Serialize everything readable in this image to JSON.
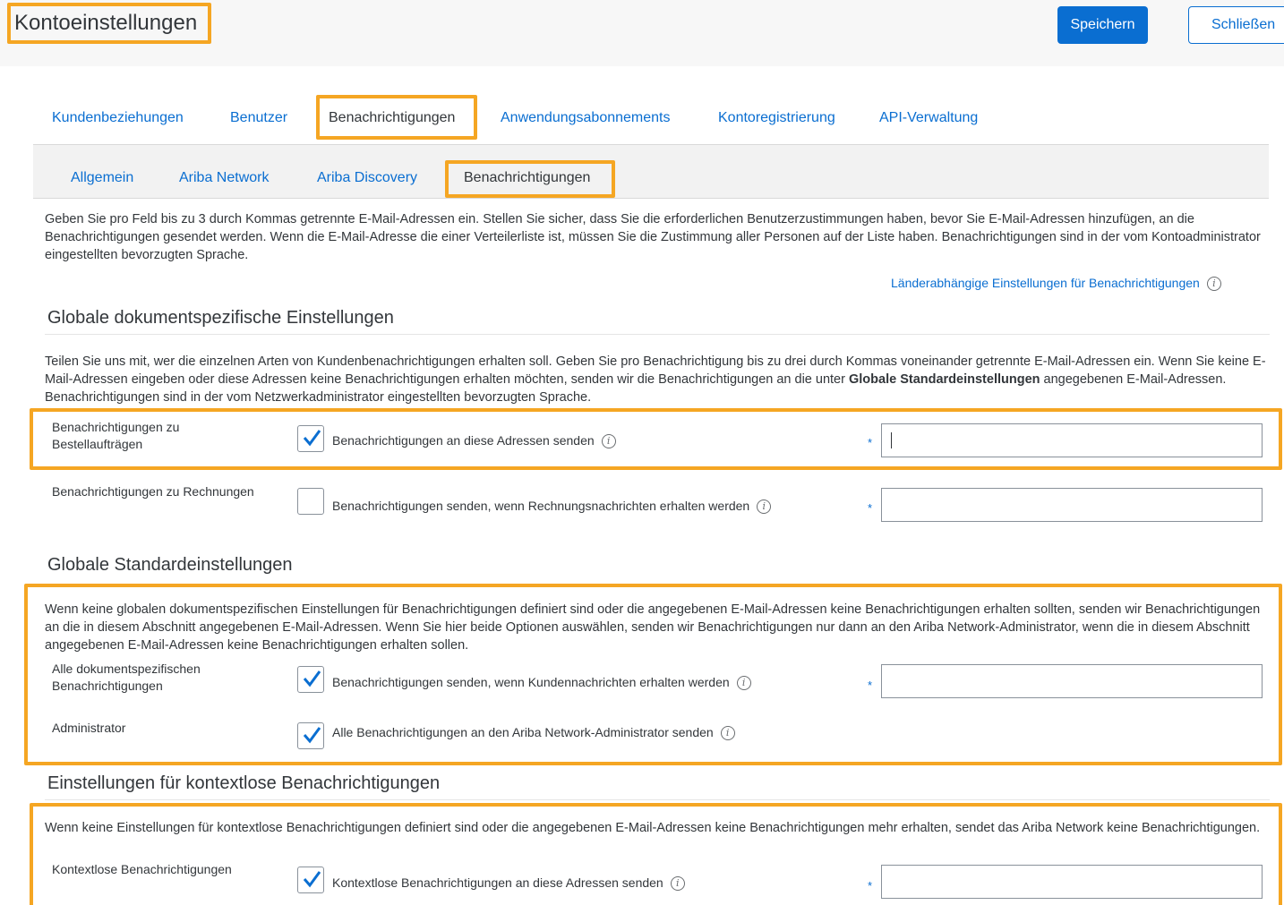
{
  "header": {
    "title": "Kontoeinstellungen",
    "save_label": "Speichern",
    "close_label": "Schließen"
  },
  "main_tabs": [
    {
      "label": "Kundenbeziehungen",
      "active": false
    },
    {
      "label": "Benutzer",
      "active": false
    },
    {
      "label": "Benachrichtigungen",
      "active": true
    },
    {
      "label": "Anwendungsabonnements",
      "active": false
    },
    {
      "label": "Kontoregistrierung",
      "active": false
    },
    {
      "label": "API-Verwaltung",
      "active": false
    }
  ],
  "sub_tabs": [
    {
      "label": "Allgemein",
      "active": false
    },
    {
      "label": "Ariba Network",
      "active": false
    },
    {
      "label": "Ariba Discovery",
      "active": false
    },
    {
      "label": "Benachrichtigungen",
      "active": true
    }
  ],
  "intro_text": "Geben Sie pro Feld bis zu 3 durch Kommas getrennte E-Mail-Adressen ein. Stellen Sie sicher, dass Sie die erforderlichen Benutzerzustimmungen haben, bevor Sie E-Mail-Adressen hinzufügen, an die Benachrichtigungen gesendet werden. Wenn die E-Mail-Adresse die einer Verteilerliste ist, müssen Sie die Zustimmung aller Personen auf der Liste haben. Benachrichtigungen sind in der vom Kontoadministrator eingestellten bevorzugten Sprache.",
  "country_link": "Länderabhängige Einstellungen für Benachrichtigungen",
  "section_global_doc": {
    "title": "Globale dokumentspezifische Einstellungen",
    "desc_part1": "Teilen Sie uns mit, wer die einzelnen Arten von Kundenbenachrichtigungen erhalten soll. Geben Sie pro Benachrichtigung bis zu drei durch Kommas voneinander getrennte E-Mail-Adressen ein. Wenn Sie keine E-Mail-Adressen eingeben oder diese Adressen keine Benachrichtigungen erhalten möchten, senden wir die Benachrichtigungen an die unter ",
    "desc_bold": "Globale Standardeinstellungen",
    "desc_part2": " angegebenen E-Mail-Adressen. Benachrichtigungen sind in der vom Netzwerkadministrator eingestellten bevorzugten Sprache.",
    "rows": [
      {
        "label": "Benachrichtigungen zu Bestellaufträgen",
        "checked": true,
        "checkbox_text": "Benachrichtigungen an diese Adressen senden",
        "required": "*",
        "input_value": ""
      },
      {
        "label": "Benachrichtigungen zu Rechnungen",
        "checked": false,
        "checkbox_text": "Benachrichtigungen senden, wenn Rechnungsnachrichten erhalten werden",
        "required": "*",
        "input_value": ""
      }
    ]
  },
  "section_global_default": {
    "title": "Globale Standardeinstellungen",
    "desc": "Wenn keine globalen dokumentspezifischen Einstellungen für Benachrichtigungen definiert sind oder die angegebenen E-Mail-Adressen keine Benachrichtigungen erhalten sollten, senden wir Benachrichtigungen an die in diesem Abschnitt angegebenen E-Mail-Adressen. Wenn Sie hier beide Optionen auswählen, senden wir Benachrichtigungen nur dann an den Ariba Network-Administrator, wenn die in diesem Abschnitt angegebenen E-Mail-Adressen keine Benachrichtigungen erhalten sollen.",
    "rows": [
      {
        "label": "Alle dokumentspezifischen Benachrichtigungen",
        "checked": true,
        "checkbox_text": "Benachrichtigungen senden, wenn Kundennachrichten erhalten werden",
        "required": "*",
        "input_value": ""
      },
      {
        "label": "Administrator",
        "checked": true,
        "checkbox_text": "Alle Benachrichtigungen an den Ariba Network-Administrator senden"
      }
    ]
  },
  "section_contextless": {
    "title": "Einstellungen für kontextlose Benachrichtigungen",
    "desc": "Wenn keine Einstellungen für kontextlose Benachrichtigungen definiert sind oder die angegebenen E-Mail-Adressen keine Benachrichtigungen mehr erhalten, sendet das Ariba Network keine Benachrichtigungen.",
    "rows": [
      {
        "label": "Kontextlose Benachrichtigungen",
        "checked": true,
        "checkbox_text": "Kontextlose Benachrichtigungen an diese Adressen senden",
        "required": "*",
        "input_value": ""
      }
    ]
  },
  "info_glyph": "i",
  "colors": {
    "accent": "#0a6ed1",
    "highlight": "#f5a623",
    "text": "#32363a"
  }
}
